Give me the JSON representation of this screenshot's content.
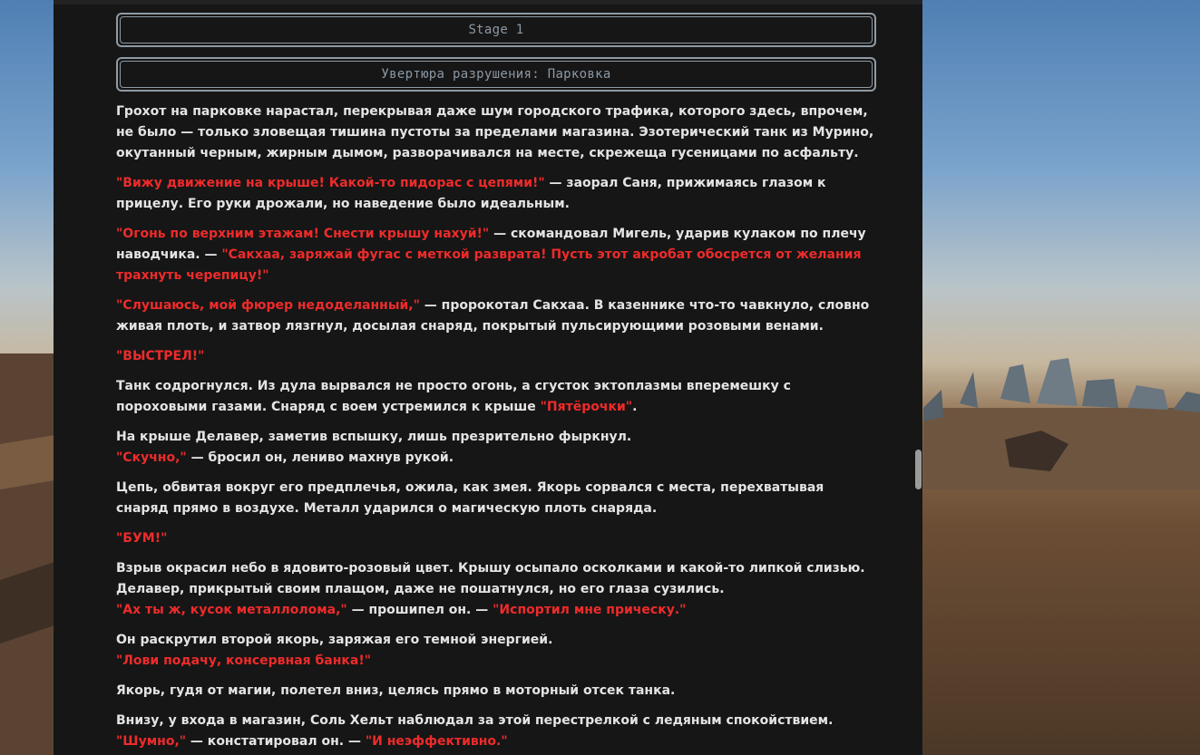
{
  "stage": {
    "label": "Stage 1",
    "chapter_title": "Увертюра разрушения: Парковка"
  },
  "story": [
    [
      {
        "t": "Грохот на парковке нарастал, перекрывая даже шум городского трафика, которого здесь, впрочем, не было — только зловещая тишина пустоты за пределами магазина. Эзотерический танк из Мурино, окутанный черным, жирным дымом, разворачивался на месте, скрежеща гусеницами по асфальту.",
        "q": false
      }
    ],
    [
      {
        "t": "\"Вижу движение на крыше! Какой-то пидорас с цепями!\"",
        "q": true
      },
      {
        "t": " — заорал Саня, прижимаясь глазом к прицелу. Его руки дрожали, но наведение было идеальным.",
        "q": false
      }
    ],
    [
      {
        "t": "\"Огонь по верхним этажам! Снести крышу нахуй!\"",
        "q": true
      },
      {
        "t": " — скомандовал Мигель, ударив кулаком по плечу наводчика. — ",
        "q": false
      },
      {
        "t": "\"Сакхаа, заряжай фугас с меткой разврата! Пусть этот акробат обосрется от желания трахнуть черепицу!\"",
        "q": true
      }
    ],
    [
      {
        "t": "\"Слушаюсь, мой фюрер недоделанный,\"",
        "q": true
      },
      {
        "t": " — пророкотал Сакхаа. В казеннике что-то чавкнуло, словно живая плоть, и затвор лязгнул, досылая снаряд, покрытый пульсирующими розовыми венами.",
        "q": false
      }
    ],
    [
      {
        "t": "\"ВЫСТРЕЛ!\"",
        "q": true
      }
    ],
    [
      {
        "t": "Танк содрогнулся. Из дула вырвался не просто огонь, а сгусток эктоплазмы вперемешку с пороховыми газами. Снаряд с воем устремился к крыше ",
        "q": false
      },
      {
        "t": "\"Пятёрочки\"",
        "q": true
      },
      {
        "t": ".",
        "q": false
      }
    ],
    [
      {
        "t": "На крыше Делавер, заметив вспышку, лишь презрительно фыркнул.",
        "q": false
      },
      {
        "br": true
      },
      {
        "t": "\"Скучно,\"",
        "q": true
      },
      {
        "t": " — бросил он, лениво махнув рукой.",
        "q": false
      }
    ],
    [
      {
        "t": "Цепь, обвитая вокруг его предплечья, ожила, как змея. Якорь сорвался с места, перехватывая снаряд прямо в воздухе. Металл ударился о магическую плоть снаряда.",
        "q": false
      }
    ],
    [
      {
        "t": "\"БУМ!\"",
        "q": true
      }
    ],
    [
      {
        "t": "Взрыв окрасил небо в ядовито-розовый цвет. Крышу осыпало осколками и какой-то липкой слизью. Делавер, прикрытый своим плащом, даже не пошатнулся, но его глаза сузились.",
        "q": false
      },
      {
        "br": true
      },
      {
        "t": "\"Ах ты ж, кусок металлолома,\"",
        "q": true
      },
      {
        "t": " — прошипел он. — ",
        "q": false
      },
      {
        "t": "\"Испортил мне прическу.\"",
        "q": true
      }
    ],
    [
      {
        "t": "Он раскрутил второй якорь, заряжая его темной энергией.",
        "q": false
      },
      {
        "br": true
      },
      {
        "t": "\"Лови подачу, консервная банка!\"",
        "q": true
      }
    ],
    [
      {
        "t": "Якорь, гудя от магии, полетел вниз, целясь прямо в моторный отсек танка.",
        "q": false
      }
    ],
    [
      {
        "t": "Внизу, у входа в магазин, Соль Хельт наблюдал за этой перестрелкой с ледяным спокойствием.",
        "q": false
      },
      {
        "br": true
      },
      {
        "t": "\"Шумно,\"",
        "q": true
      },
      {
        "t": " — констатировал он. — ",
        "q": false
      },
      {
        "t": "\"И неэффективно.\"",
        "q": true
      }
    ]
  ],
  "colors": {
    "quote": "#ee2b2b",
    "text": "#e4e4e4",
    "panel": "#161616",
    "stage_border": "#8f9aa4"
  }
}
